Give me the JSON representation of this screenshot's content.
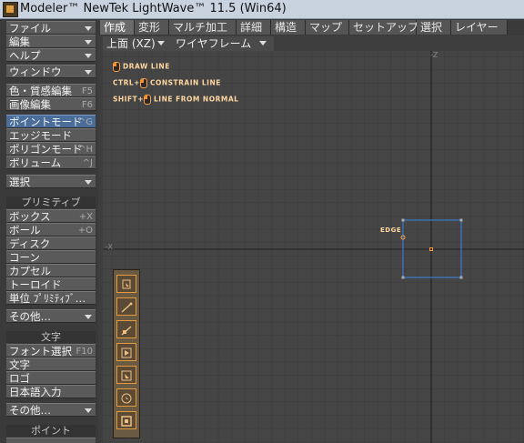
{
  "window": {
    "title": "Modeler™ NewTek LightWave™ 11.5 (Win64)"
  },
  "sidebar": {
    "menus": [
      {
        "label": "ファイル"
      },
      {
        "label": "編集"
      },
      {
        "label": "ヘルプ"
      },
      {
        "label": "ウィンドウ"
      }
    ],
    "surface_editor": {
      "label": "色・質感編集",
      "shortcut": "F5"
    },
    "image_editor": {
      "label": "画像編集",
      "shortcut": "F6"
    },
    "modes": [
      {
        "label": "ポイントモード",
        "shortcut": "^G",
        "active": true
      },
      {
        "label": "エッジモード",
        "shortcut": ""
      },
      {
        "label": "ポリゴンモード",
        "shortcut": "^H"
      },
      {
        "label": "ボリューム",
        "shortcut": "^J"
      }
    ],
    "select_label": "選択",
    "primitive_heading": "プリミティブ",
    "primitives": [
      {
        "label": "ボックス",
        "shortcut": "+X"
      },
      {
        "label": "ボール",
        "shortcut": "+O"
      },
      {
        "label": "ディスク",
        "shortcut": ""
      },
      {
        "label": "コーン",
        "shortcut": ""
      },
      {
        "label": "カプセル",
        "shortcut": ""
      },
      {
        "label": "トーロイド",
        "shortcut": ""
      },
      {
        "label": "単位 ﾌﾟﾘﾐﾃｨﾌﾞ…",
        "shortcut": ""
      }
    ],
    "more_label_1": "その他…",
    "text_heading": "文字",
    "text_items": [
      {
        "label": "フォント選択",
        "shortcut": "F10"
      },
      {
        "label": "文字",
        "shortcut": ""
      },
      {
        "label": "ロゴ",
        "shortcut": ""
      },
      {
        "label": "日本語入力",
        "shortcut": ""
      }
    ],
    "more_label_2": "その他…",
    "point_heading": "ポイント"
  },
  "tabs": [
    {
      "label": "作成",
      "active": true
    },
    {
      "label": "変形"
    },
    {
      "label": "マルチ加工"
    },
    {
      "label": "詳細"
    },
    {
      "label": "構造"
    },
    {
      "label": "マップ"
    },
    {
      "label": "セットアップ"
    },
    {
      "label": "選択"
    },
    {
      "label": "レイヤー"
    }
  ],
  "viewport": {
    "view_label": "上面 (XZ)",
    "render_mode": "ワイヤフレーム",
    "hints": [
      {
        "prefix": "",
        "text": "DRAW LINE"
      },
      {
        "prefix": "CTRL+",
        "text": "CONSTRAIN LINE"
      },
      {
        "prefix": "SHIFT+",
        "text": "LINE FROM NORMAL"
      }
    ],
    "edge_label": "EDGE",
    "axis_top": "-Z",
    "axis_left": "-X"
  },
  "tools": [
    {
      "icon": "point-tool-icon"
    },
    {
      "icon": "line-tool-icon"
    },
    {
      "icon": "line-normal-tool-icon"
    },
    {
      "icon": "play-tool-icon"
    },
    {
      "icon": "extend-tool-icon"
    },
    {
      "icon": "circle-tool-icon"
    },
    {
      "icon": "square-tool-icon"
    }
  ],
  "colors": {
    "accent": "#4a6d9a",
    "hint": "#ffd7a0",
    "selection": "#3a78d0",
    "tool_border": "#e09a40"
  }
}
